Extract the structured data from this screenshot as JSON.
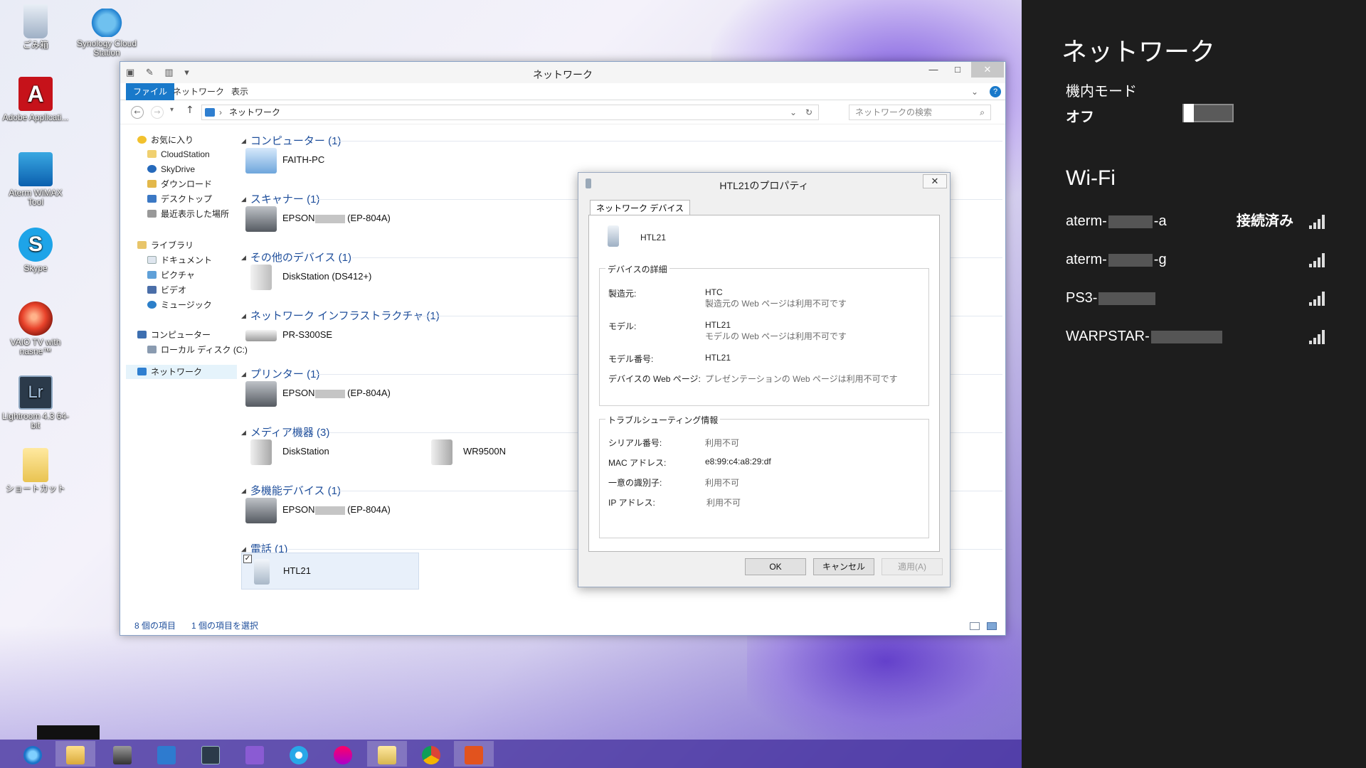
{
  "desktop": {
    "icons": [
      {
        "label": "ごみ箱",
        "icon": "recycle-bin-icon"
      },
      {
        "label": "Synology Cloud Station",
        "icon": "cloud-station-icon"
      },
      {
        "label": "Adobe Applicati...",
        "icon": "adobe-icon"
      },
      {
        "label": "Aterm WiMAX Tool",
        "icon": "wimax-icon"
      },
      {
        "label": "Skype",
        "icon": "skype-icon"
      },
      {
        "label": "VAIO TV with nasne™",
        "icon": "vaio-tv-icon"
      },
      {
        "label": "Lightroom 4.3 64-bit",
        "icon": "lightroom-icon"
      },
      {
        "label": "ショートカット",
        "icon": "folder-shortcut-icon"
      }
    ]
  },
  "explorer": {
    "title": "ネットワーク",
    "ribbon_tabs": [
      "ファイル",
      "ネットワーク",
      "表示"
    ],
    "address": "ネットワーク",
    "search_placeholder": "ネットワークの検索",
    "nav": {
      "favorites": "お気に入り",
      "favorites_items": [
        "CloudStation",
        "SkyDrive",
        "ダウンロード",
        "デスクトップ",
        "最近表示した場所"
      ],
      "libraries": "ライブラリ",
      "libraries_items": [
        "ドキュメント",
        "ピクチャ",
        "ビデオ",
        "ミュージック"
      ],
      "computer": "コンピューター",
      "computer_items": [
        "ローカル ディスク (C:)"
      ],
      "network": "ネットワーク"
    },
    "groups": [
      {
        "title": "コンピューター (1)",
        "items": [
          {
            "name": "FAITH-PC"
          }
        ]
      },
      {
        "title": "スキャナー (1)",
        "items": [
          {
            "name_a": "EPSON",
            "name_b": "(EP-804A)"
          }
        ]
      },
      {
        "title": "その他のデバイス (1)",
        "items": [
          {
            "name": "DiskStation (DS412+)"
          }
        ]
      },
      {
        "title": "ネットワーク インフラストラクチャ (1)",
        "items": [
          {
            "name": "PR-S300SE"
          }
        ]
      },
      {
        "title": "プリンター (1)",
        "items": [
          {
            "name_a": "EPSON",
            "name_b": "(EP-804A)"
          }
        ]
      },
      {
        "title": "メディア機器 (3)",
        "items": [
          {
            "name": "DiskStation"
          },
          {
            "name": "WR9500N"
          }
        ]
      },
      {
        "title": "多機能デバイス (1)",
        "items": [
          {
            "name_a": "EPSON",
            "name_b": "(EP-804A)"
          }
        ]
      },
      {
        "title": "電話 (1)",
        "items": [
          {
            "name": "HTL21"
          }
        ]
      }
    ],
    "status_count": "8 個の項目",
    "status_selected": "1 個の項目を選択"
  },
  "dialog": {
    "title": "HTL21のプロパティ",
    "tab": "ネットワーク デバイス",
    "device_name": "HTL21",
    "details_legend": "デバイスの詳細",
    "details": [
      {
        "key": "製造元:",
        "value": "HTC",
        "sub": "製造元の Web ページは利用不可です"
      },
      {
        "key": "モデル:",
        "value": "HTL21",
        "sub": "モデルの Web ページは利用不可です"
      },
      {
        "key": "モデル番号:",
        "value": "HTL21",
        "sub": ""
      },
      {
        "key": "デバイスの Web ページ:",
        "value": "プレゼンテーションの Web ページは利用不可です",
        "sub": ""
      }
    ],
    "trouble_legend": "トラブルシューティング情報",
    "trouble": [
      {
        "key": "シリアル番号:",
        "value": "利用不可"
      },
      {
        "key": "MAC アドレス:",
        "value": "e8:99:c4:a8:29:df"
      },
      {
        "key": "一意の識別子:",
        "value": "利用不可"
      },
      {
        "key": "IP アドレス:",
        "value": "利用不可"
      }
    ],
    "buttons": {
      "ok": "OK",
      "cancel": "キャンセル",
      "apply": "適用(A)"
    }
  },
  "charm": {
    "title": "ネットワーク",
    "airplane_label": "機内モード",
    "airplane_state": "オフ",
    "wifi_title": "Wi-Fi",
    "networks": [
      {
        "prefix": "aterm-",
        "suffix": "-a",
        "status": "接続済み"
      },
      {
        "prefix": "aterm-",
        "suffix": "-g",
        "status": ""
      },
      {
        "prefix": "PS3-",
        "suffix": "",
        "status": ""
      },
      {
        "prefix": "WARPSTAR-",
        "suffix": "",
        "status": ""
      }
    ]
  },
  "taskbar": {
    "apps": [
      "internet-explorer-icon",
      "file-explorer-icon",
      "app-icon",
      "app-icon",
      "lightroom-icon",
      "app-icon",
      "media-icon",
      "app-icon",
      "folder-icon",
      "chrome-icon",
      "office-icon"
    ]
  }
}
